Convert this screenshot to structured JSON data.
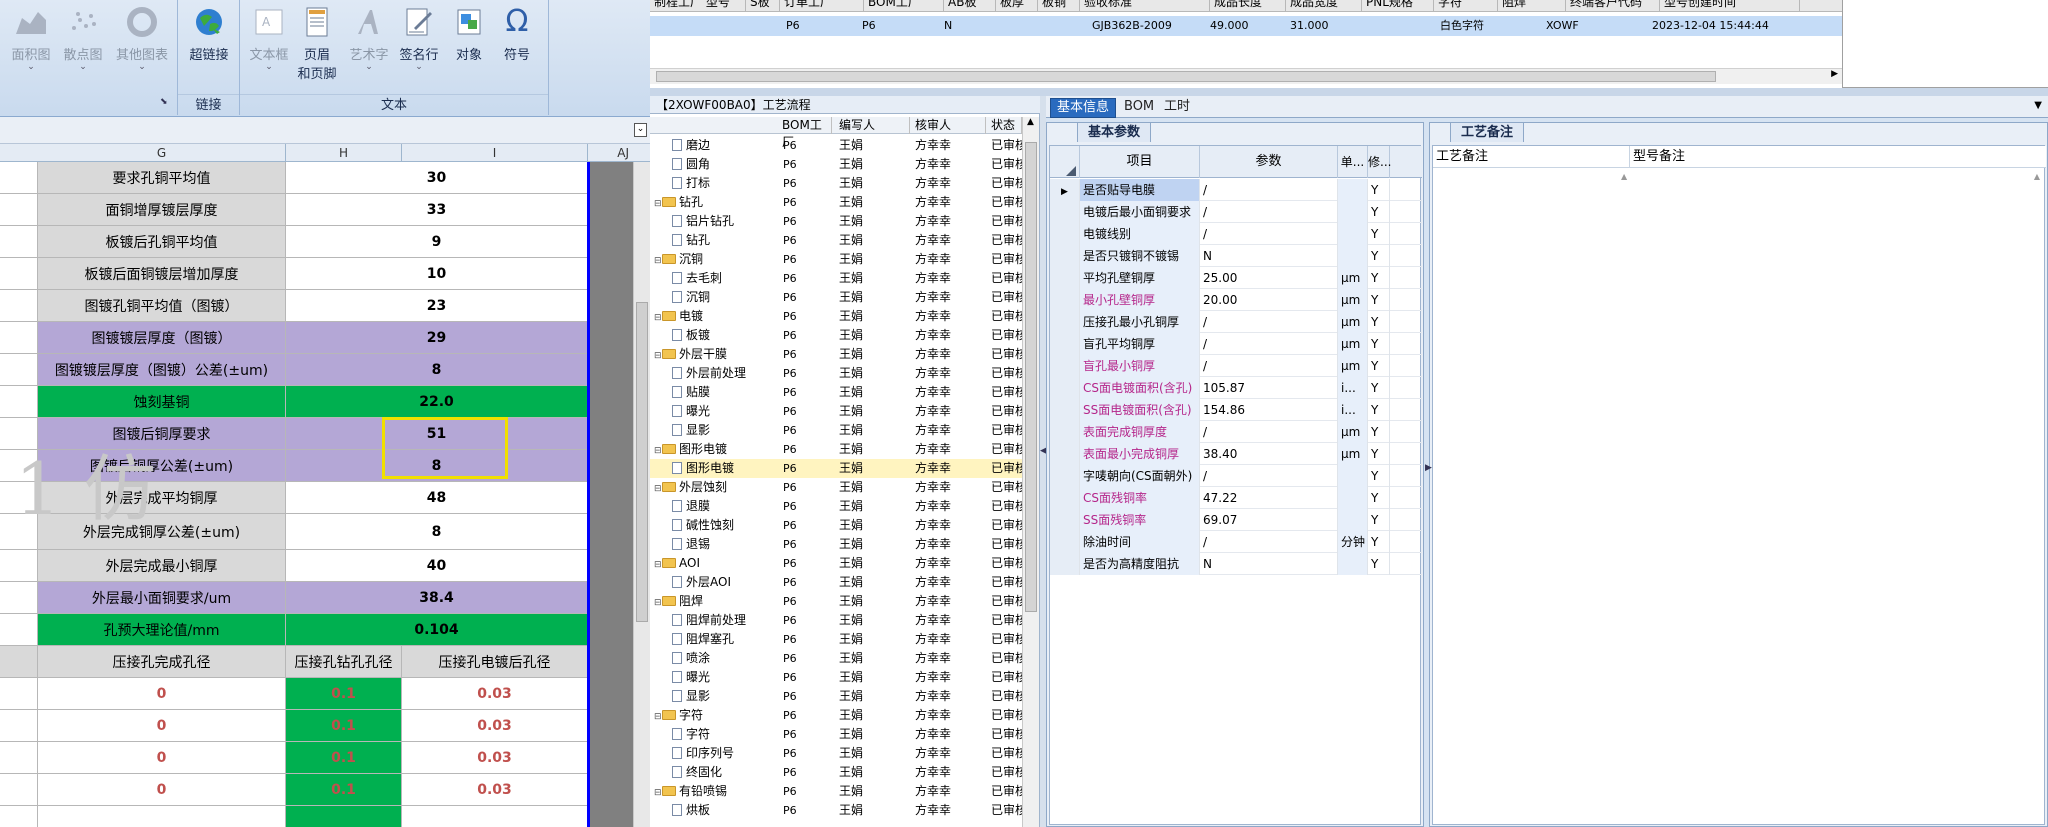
{
  "ribbon": {
    "charts": [
      {
        "label": "面积图",
        "gray": true
      },
      {
        "label": "散点图",
        "gray": true
      },
      {
        "label": "其他图表",
        "gray": true
      }
    ],
    "links": {
      "label": "超链接",
      "group": "链接"
    },
    "text_group": {
      "group": "文本",
      "buttons": [
        {
          "label": "文本框",
          "gray": true
        },
        {
          "label": "页眉",
          "label2": "和页脚",
          "gray": false
        },
        {
          "label": "艺术字",
          "gray": true
        },
        {
          "label": "签名行",
          "gray": false
        },
        {
          "label": "对象",
          "gray": false
        },
        {
          "label": "符号",
          "gray": false
        }
      ]
    },
    "partial_left_label": "图"
  },
  "sheet": {
    "columns": [
      "G",
      "H",
      "I",
      "AJ"
    ],
    "rows": [
      {
        "g": "要求孔铜平均值",
        "h": "30",
        "i": "",
        "style": "gray-white"
      },
      {
        "g": "面铜增厚镀层厚度",
        "h": "33",
        "i": "",
        "style": "gray-white"
      },
      {
        "g": "板镀后孔铜平均值",
        "h": "9",
        "i": "",
        "style": "gray-white"
      },
      {
        "g": "板镀后面铜镀层增加厚度",
        "h": "10",
        "i": "",
        "style": "gray-white"
      },
      {
        "g": "图镀孔铜平均值（图镀）",
        "h": "23",
        "i": "",
        "style": "gray-white"
      },
      {
        "g": "图镀镀层厚度（图镀）",
        "h": "29",
        "i": "",
        "style": "purple"
      },
      {
        "g": "图镀镀层厚度（图镀）公差(±um)",
        "h": "8",
        "i": "",
        "style": "purple"
      },
      {
        "g": "蚀刻基铜",
        "h": "22.0",
        "i": "",
        "style": "green"
      },
      {
        "g": "图镀后铜厚要求",
        "h": "51",
        "i": "",
        "style": "purple"
      },
      {
        "g": "图镀后铜厚公差(±um)",
        "h": "8",
        "i": "",
        "style": "purple"
      },
      {
        "g": "外层完成平均铜厚",
        "h": "48",
        "i": "",
        "style": "gray-white"
      },
      {
        "g": "外层完成铜厚公差(±um)",
        "h": "8",
        "i": "",
        "style": "gray-white"
      },
      {
        "g": "外层完成最小铜厚",
        "h": "40",
        "i": "",
        "style": "gray-white"
      },
      {
        "g": "外层最小面铜要求/um",
        "h": "38.4",
        "i": "",
        "style": "purple"
      },
      {
        "g": "孔预大理论值/mm",
        "h": "0.104",
        "i": "",
        "style": "green"
      }
    ],
    "sub_header": {
      "g": "压接孔完成孔径",
      "h": "压接孔钻孔孔径",
      "i": "压接孔电镀后孔径"
    },
    "sub_rows": [
      {
        "g": "0",
        "h": "0.1",
        "i": "0.03"
      },
      {
        "g": "0",
        "h": "0.1",
        "i": "0.03"
      },
      {
        "g": "0",
        "h": "0.1",
        "i": "0.03"
      },
      {
        "g": "0",
        "h": "0.1",
        "i": "0.03"
      }
    ],
    "watermark": "1 仿"
  },
  "top_table": {
    "headers": [
      "制程工厂 型号",
      "S板",
      "订单工厂",
      "BOM工厂",
      "AB板",
      "板厚",
      "板铜",
      "验收标准",
      "成品长度",
      "成品宽度",
      "PNL规格",
      "字符",
      "阻焊",
      "终端客户代码",
      "型号创建时间"
    ],
    "row": [
      "P6",
      "P6",
      "N",
      "GJB362B-2009",
      "49.000",
      "31.000",
      "白色字符",
      "XOWF",
      "2023-12-04 15:44:44"
    ]
  },
  "tree": {
    "title": "【2XOWF00BA0】工艺流程",
    "headers": [
      "BOM工厂",
      "编写人",
      "核审人",
      "状态"
    ],
    "rows": [
      {
        "name": "磨边",
        "level": 1,
        "type": "doc",
        "bom": "P6",
        "writer": "王娟",
        "reviewer": "方幸幸",
        "status": "已审核"
      },
      {
        "name": "圆角",
        "level": 1,
        "type": "doc",
        "bom": "P6",
        "writer": "王娟",
        "reviewer": "方幸幸",
        "status": "已审核"
      },
      {
        "name": "打标",
        "level": 1,
        "type": "doc",
        "bom": "P6",
        "writer": "王娟",
        "reviewer": "方幸幸",
        "status": "已审核"
      },
      {
        "name": "钻孔",
        "level": 0,
        "type": "folder",
        "bom": "P6",
        "writer": "王娟",
        "reviewer": "方幸幸",
        "status": "已审核"
      },
      {
        "name": "铝片钻孔",
        "level": 1,
        "type": "doc",
        "bom": "P6",
        "writer": "王娟",
        "reviewer": "方幸幸",
        "status": "已审核"
      },
      {
        "name": "钻孔",
        "level": 1,
        "type": "doc",
        "bom": "P6",
        "writer": "王娟",
        "reviewer": "方幸幸",
        "status": "已审核"
      },
      {
        "name": "沉铜",
        "level": 0,
        "type": "folder",
        "bom": "P6",
        "writer": "王娟",
        "reviewer": "方幸幸",
        "status": "已审核"
      },
      {
        "name": "去毛刺",
        "level": 1,
        "type": "doc",
        "bom": "P6",
        "writer": "王娟",
        "reviewer": "方幸幸",
        "status": "已审核"
      },
      {
        "name": "沉铜",
        "level": 1,
        "type": "doc",
        "bom": "P6",
        "writer": "王娟",
        "reviewer": "方幸幸",
        "status": "已审核"
      },
      {
        "name": "电镀",
        "level": 0,
        "type": "folder",
        "bom": "P6",
        "writer": "王娟",
        "reviewer": "方幸幸",
        "status": "已审核"
      },
      {
        "name": "板镀",
        "level": 1,
        "type": "doc",
        "bom": "P6",
        "writer": "王娟",
        "reviewer": "方幸幸",
        "status": "已审核"
      },
      {
        "name": "外层干膜",
        "level": 0,
        "type": "folder",
        "bom": "P6",
        "writer": "王娟",
        "reviewer": "方幸幸",
        "status": "已审核"
      },
      {
        "name": "外层前处理",
        "level": 1,
        "type": "doc",
        "bom": "P6",
        "writer": "王娟",
        "reviewer": "方幸幸",
        "status": "已审核"
      },
      {
        "name": "贴膜",
        "level": 1,
        "type": "doc",
        "bom": "P6",
        "writer": "王娟",
        "reviewer": "方幸幸",
        "status": "已审核"
      },
      {
        "name": "曝光",
        "level": 1,
        "type": "doc",
        "bom": "P6",
        "writer": "王娟",
        "reviewer": "方幸幸",
        "status": "已审核"
      },
      {
        "name": "显影",
        "level": 1,
        "type": "doc",
        "bom": "P6",
        "writer": "王娟",
        "reviewer": "方幸幸",
        "status": "已审核"
      },
      {
        "name": "图形电镀",
        "level": 0,
        "type": "folder",
        "bom": "P6",
        "writer": "王娟",
        "reviewer": "方幸幸",
        "status": "已审核"
      },
      {
        "name": "图形电镀",
        "level": 1,
        "type": "doc",
        "bom": "P6",
        "writer": "王娟",
        "reviewer": "方幸幸",
        "status": "已审核",
        "selected": true
      },
      {
        "name": "外层蚀刻",
        "level": 0,
        "type": "folder",
        "bom": "P6",
        "writer": "王娟",
        "reviewer": "方幸幸",
        "status": "已审核"
      },
      {
        "name": "退膜",
        "level": 1,
        "type": "doc",
        "bom": "P6",
        "writer": "王娟",
        "reviewer": "方幸幸",
        "status": "已审核"
      },
      {
        "name": "碱性蚀刻",
        "level": 1,
        "type": "doc",
        "bom": "P6",
        "writer": "王娟",
        "reviewer": "方幸幸",
        "status": "已审核"
      },
      {
        "name": "退锡",
        "level": 1,
        "type": "doc",
        "bom": "P6",
        "writer": "王娟",
        "reviewer": "方幸幸",
        "status": "已审核"
      },
      {
        "name": "AOI",
        "level": 0,
        "type": "folder",
        "bom": "P6",
        "writer": "王娟",
        "reviewer": "方幸幸",
        "status": "已审核"
      },
      {
        "name": "外层AOI",
        "level": 1,
        "type": "doc",
        "bom": "P6",
        "writer": "王娟",
        "reviewer": "方幸幸",
        "status": "已审核"
      },
      {
        "name": "阻焊",
        "level": 0,
        "type": "folder",
        "bom": "P6",
        "writer": "王娟",
        "reviewer": "方幸幸",
        "status": "已审核"
      },
      {
        "name": "阻焊前处理",
        "level": 1,
        "type": "doc",
        "bom": "P6",
        "writer": "王娟",
        "reviewer": "方幸幸",
        "status": "已审核"
      },
      {
        "name": "阻焊塞孔",
        "level": 1,
        "type": "doc",
        "bom": "P6",
        "writer": "王娟",
        "reviewer": "方幸幸",
        "status": "已审核"
      },
      {
        "name": "喷涂",
        "level": 1,
        "type": "doc",
        "bom": "P6",
        "writer": "王娟",
        "reviewer": "方幸幸",
        "status": "已审核"
      },
      {
        "name": "曝光",
        "level": 1,
        "type": "doc",
        "bom": "P6",
        "writer": "王娟",
        "reviewer": "方幸幸",
        "status": "已审核"
      },
      {
        "name": "显影",
        "level": 1,
        "type": "doc",
        "bom": "P6",
        "writer": "王娟",
        "reviewer": "方幸幸",
        "status": "已审核"
      },
      {
        "name": "字符",
        "level": 0,
        "type": "folder",
        "bom": "P6",
        "writer": "王娟",
        "reviewer": "方幸幸",
        "status": "已审核"
      },
      {
        "name": "字符",
        "level": 1,
        "type": "doc",
        "bom": "P6",
        "writer": "王娟",
        "reviewer": "方幸幸",
        "status": "已审核"
      },
      {
        "name": "印序列号",
        "level": 1,
        "type": "doc",
        "bom": "P6",
        "writer": "王娟",
        "reviewer": "方幸幸",
        "status": "已审核"
      },
      {
        "name": "终固化",
        "level": 1,
        "type": "doc",
        "bom": "P6",
        "writer": "王娟",
        "reviewer": "方幸幸",
        "status": "已审核"
      },
      {
        "name": "有铅喷锡",
        "level": 0,
        "type": "folder",
        "bom": "P6",
        "writer": "王娟",
        "reviewer": "方幸幸",
        "status": "已审核"
      },
      {
        "name": "烘板",
        "level": 1,
        "type": "doc",
        "bom": "P6",
        "writer": "王娟",
        "reviewer": "方幸幸",
        "status": "已审核"
      }
    ]
  },
  "info": {
    "tabs": [
      "基本信息",
      "BOM",
      "工时"
    ],
    "left_subtab": "基本参数",
    "right_subtab": "工艺备注",
    "grid_headers": [
      "项目",
      "参数",
      "单...",
      "修..."
    ],
    "grid_rows": [
      {
        "item": "是否贴导电膜",
        "param": "/",
        "unit": "",
        "mod": "Y",
        "magenta": false,
        "selected": true
      },
      {
        "item": "电镀后最小面铜要求",
        "param": "/",
        "unit": "",
        "mod": "Y",
        "magenta": false
      },
      {
        "item": "电镀线别",
        "param": "/",
        "unit": "",
        "mod": "Y",
        "magenta": false
      },
      {
        "item": "是否只镀铜不镀锡",
        "param": "N",
        "unit": "",
        "mod": "Y",
        "magenta": false
      },
      {
        "item": "平均孔壁铜厚",
        "param": "25.00",
        "unit": "μm",
        "mod": "Y",
        "magenta": false
      },
      {
        "item": "最小孔壁铜厚",
        "param": "20.00",
        "unit": "μm",
        "mod": "Y",
        "magenta": true
      },
      {
        "item": "压接孔最小孔铜厚",
        "param": "/",
        "unit": "μm",
        "mod": "Y",
        "magenta": false
      },
      {
        "item": "盲孔平均铜厚",
        "param": "/",
        "unit": "μm",
        "mod": "Y",
        "magenta": false
      },
      {
        "item": "盲孔最小铜厚",
        "param": "/",
        "unit": "μm",
        "mod": "Y",
        "magenta": true
      },
      {
        "item": "CS面电镀面积(含孔)",
        "param": "105.87",
        "unit": "i...",
        "mod": "Y",
        "magenta": true
      },
      {
        "item": "SS面电镀面积(含孔)",
        "param": "154.86",
        "unit": "i...",
        "mod": "Y",
        "magenta": true
      },
      {
        "item": "表面完成铜厚度",
        "param": "/",
        "unit": "μm",
        "mod": "Y",
        "magenta": true
      },
      {
        "item": "表面最小完成铜厚",
        "param": "38.40",
        "unit": "μm",
        "mod": "Y",
        "magenta": true
      },
      {
        "item": "字唛朝向(CS面朝外)",
        "param": "/",
        "unit": "",
        "mod": "Y",
        "magenta": false
      },
      {
        "item": "CS面残铜率",
        "param": "47.22",
        "unit": "",
        "mod": "Y",
        "magenta": true
      },
      {
        "item": "SS面残铜率",
        "param": "69.07",
        "unit": "",
        "mod": "Y",
        "magenta": true
      },
      {
        "item": "除油时间",
        "param": "/",
        "unit": "分钟",
        "mod": "Y",
        "magenta": false
      },
      {
        "item": "是否为高精度阻抗",
        "param": "N",
        "unit": "",
        "mod": "Y",
        "magenta": false
      }
    ],
    "remark_headers": [
      "工艺备注",
      "型号备注"
    ]
  }
}
